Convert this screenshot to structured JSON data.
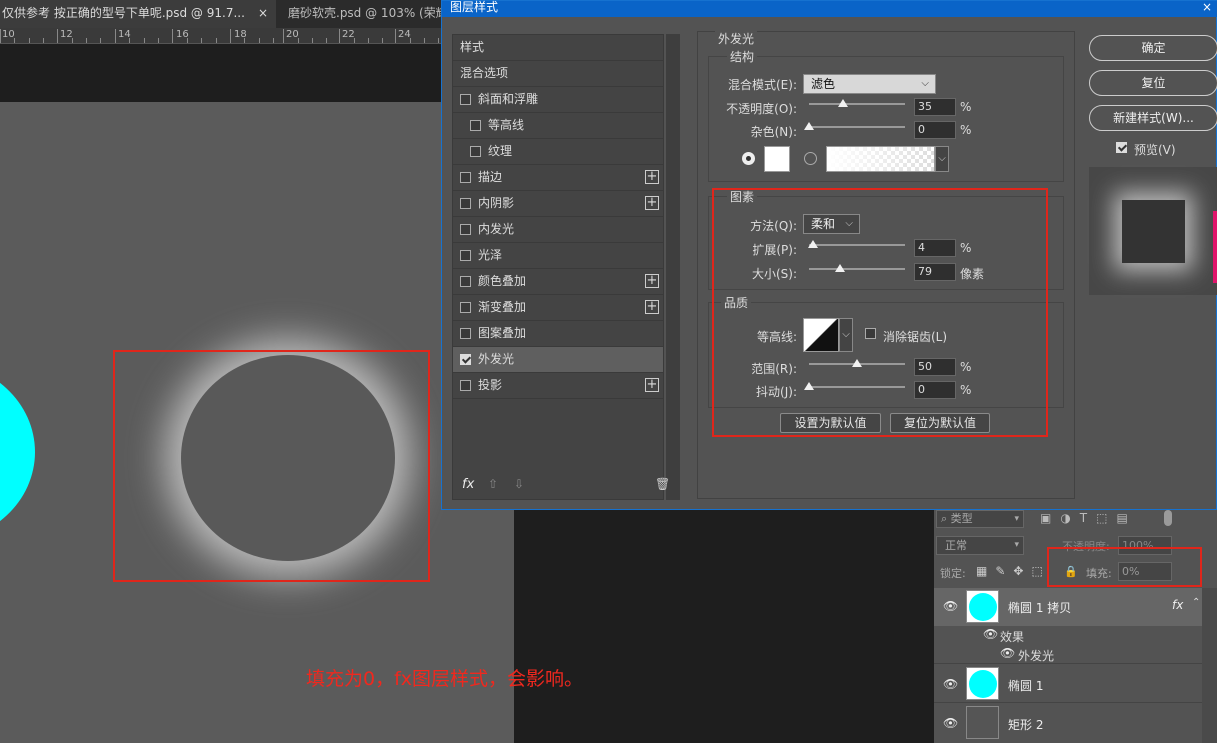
{
  "tabs": [
    {
      "label": "仅供参考 按正确的型号下单呢.psd @ 91.7...",
      "close": "×"
    },
    {
      "label": "磨砂软壳.psd @ 103% (荣耀..."
    }
  ],
  "ruler": [
    "10",
    "12",
    "14",
    "16",
    "18",
    "20",
    "22",
    "24"
  ],
  "canvas": {
    "annotation": "填充为0，fx图层样式，会影响。"
  },
  "dialog": {
    "title": "图层样式",
    "close": "×",
    "style_list": {
      "header": "样式",
      "blend_options": "混合选项",
      "items": [
        {
          "label": "斜面和浮雕",
          "checked": false,
          "plus": false,
          "indent": 0
        },
        {
          "label": "等高线",
          "checked": false,
          "plus": false,
          "indent": 1
        },
        {
          "label": "纹理",
          "checked": false,
          "plus": false,
          "indent": 1
        },
        {
          "label": "描边",
          "checked": false,
          "plus": true,
          "indent": 0
        },
        {
          "label": "内阴影",
          "checked": false,
          "plus": true,
          "indent": 0
        },
        {
          "label": "内发光",
          "checked": false,
          "plus": false,
          "indent": 0
        },
        {
          "label": "光泽",
          "checked": false,
          "plus": false,
          "indent": 0
        },
        {
          "label": "颜色叠加",
          "checked": false,
          "plus": true,
          "indent": 0
        },
        {
          "label": "渐变叠加",
          "checked": false,
          "plus": true,
          "indent": 0
        },
        {
          "label": "图案叠加",
          "checked": false,
          "plus": false,
          "indent": 0
        },
        {
          "label": "外发光",
          "checked": true,
          "plus": false,
          "indent": 0
        },
        {
          "label": "投影",
          "checked": false,
          "plus": true,
          "indent": 0
        }
      ],
      "footer_fx": "fx",
      "footer_up": "⇧",
      "footer_down": "⇩",
      "footer_trash": "🗑"
    },
    "outer_glow": {
      "title": "外发光",
      "structure": {
        "title": "结构",
        "blend_mode_label": "混合模式(E):",
        "blend_mode": "滤色",
        "opacity_label": "不透明度(O):",
        "opacity": "35",
        "opacity_fraction": 0.35,
        "noise_label": "杂色(N):",
        "noise": "0",
        "noise_fraction": 0.0,
        "unit": "%"
      },
      "elements": {
        "title": "图素",
        "technique_label": "方法(Q):",
        "technique": "柔和",
        "spread_label": "扩展(P):",
        "spread": "4",
        "spread_fraction": 0.04,
        "size_label": "大小(S):",
        "size": "79",
        "size_fraction": 0.32,
        "size_unit": "像素",
        "unit": "%"
      },
      "quality": {
        "title": "品质",
        "contour_label": "等高线:",
        "antialias_label": "消除锯齿(L)",
        "range_label": "范围(R):",
        "range": "50",
        "range_fraction": 0.5,
        "jitter_label": "抖动(J):",
        "jitter": "0",
        "jitter_fraction": 0.0,
        "unit": "%"
      },
      "make_default": "设置为默认值",
      "reset_default": "复位为默认值"
    },
    "buttons": {
      "ok": "确定",
      "reset": "复位",
      "new_style": "新建样式(W)...",
      "preview": "预览(V)"
    }
  },
  "layers": {
    "filter": "类型",
    "blend": "正常",
    "opacity_label": "不透明度:",
    "opacity": "100%",
    "lock_label": "锁定:",
    "fill_label": "填充:",
    "fill": "0%",
    "rows": {
      "layer1": "椭圆 1 拷贝",
      "layer1_fx": "fx",
      "effects": "效果",
      "outer_glow": "外发光",
      "layer2": "椭圆 1",
      "layer3": "矩形 2"
    }
  },
  "colors": {
    "accent_blue": "#0a64c8",
    "cyan": "#00ffff",
    "annotation_red": "#e0261b"
  }
}
